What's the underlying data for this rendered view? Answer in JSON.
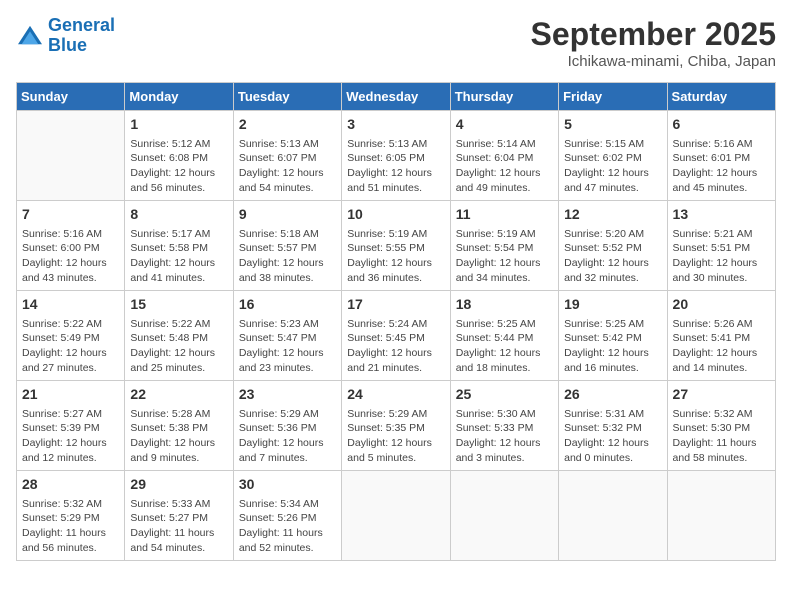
{
  "logo": {
    "line1": "General",
    "line2": "Blue"
  },
  "title": "September 2025",
  "subtitle": "Ichikawa-minami, Chiba, Japan",
  "headers": [
    "Sunday",
    "Monday",
    "Tuesday",
    "Wednesday",
    "Thursday",
    "Friday",
    "Saturday"
  ],
  "weeks": [
    [
      {
        "day": "",
        "info": ""
      },
      {
        "day": "1",
        "info": "Sunrise: 5:12 AM\nSunset: 6:08 PM\nDaylight: 12 hours\nand 56 minutes."
      },
      {
        "day": "2",
        "info": "Sunrise: 5:13 AM\nSunset: 6:07 PM\nDaylight: 12 hours\nand 54 minutes."
      },
      {
        "day": "3",
        "info": "Sunrise: 5:13 AM\nSunset: 6:05 PM\nDaylight: 12 hours\nand 51 minutes."
      },
      {
        "day": "4",
        "info": "Sunrise: 5:14 AM\nSunset: 6:04 PM\nDaylight: 12 hours\nand 49 minutes."
      },
      {
        "day": "5",
        "info": "Sunrise: 5:15 AM\nSunset: 6:02 PM\nDaylight: 12 hours\nand 47 minutes."
      },
      {
        "day": "6",
        "info": "Sunrise: 5:16 AM\nSunset: 6:01 PM\nDaylight: 12 hours\nand 45 minutes."
      }
    ],
    [
      {
        "day": "7",
        "info": "Sunrise: 5:16 AM\nSunset: 6:00 PM\nDaylight: 12 hours\nand 43 minutes."
      },
      {
        "day": "8",
        "info": "Sunrise: 5:17 AM\nSunset: 5:58 PM\nDaylight: 12 hours\nand 41 minutes."
      },
      {
        "day": "9",
        "info": "Sunrise: 5:18 AM\nSunset: 5:57 PM\nDaylight: 12 hours\nand 38 minutes."
      },
      {
        "day": "10",
        "info": "Sunrise: 5:19 AM\nSunset: 5:55 PM\nDaylight: 12 hours\nand 36 minutes."
      },
      {
        "day": "11",
        "info": "Sunrise: 5:19 AM\nSunset: 5:54 PM\nDaylight: 12 hours\nand 34 minutes."
      },
      {
        "day": "12",
        "info": "Sunrise: 5:20 AM\nSunset: 5:52 PM\nDaylight: 12 hours\nand 32 minutes."
      },
      {
        "day": "13",
        "info": "Sunrise: 5:21 AM\nSunset: 5:51 PM\nDaylight: 12 hours\nand 30 minutes."
      }
    ],
    [
      {
        "day": "14",
        "info": "Sunrise: 5:22 AM\nSunset: 5:49 PM\nDaylight: 12 hours\nand 27 minutes."
      },
      {
        "day": "15",
        "info": "Sunrise: 5:22 AM\nSunset: 5:48 PM\nDaylight: 12 hours\nand 25 minutes."
      },
      {
        "day": "16",
        "info": "Sunrise: 5:23 AM\nSunset: 5:47 PM\nDaylight: 12 hours\nand 23 minutes."
      },
      {
        "day": "17",
        "info": "Sunrise: 5:24 AM\nSunset: 5:45 PM\nDaylight: 12 hours\nand 21 minutes."
      },
      {
        "day": "18",
        "info": "Sunrise: 5:25 AM\nSunset: 5:44 PM\nDaylight: 12 hours\nand 18 minutes."
      },
      {
        "day": "19",
        "info": "Sunrise: 5:25 AM\nSunset: 5:42 PM\nDaylight: 12 hours\nand 16 minutes."
      },
      {
        "day": "20",
        "info": "Sunrise: 5:26 AM\nSunset: 5:41 PM\nDaylight: 12 hours\nand 14 minutes."
      }
    ],
    [
      {
        "day": "21",
        "info": "Sunrise: 5:27 AM\nSunset: 5:39 PM\nDaylight: 12 hours\nand 12 minutes."
      },
      {
        "day": "22",
        "info": "Sunrise: 5:28 AM\nSunset: 5:38 PM\nDaylight: 12 hours\nand 9 minutes."
      },
      {
        "day": "23",
        "info": "Sunrise: 5:29 AM\nSunset: 5:36 PM\nDaylight: 12 hours\nand 7 minutes."
      },
      {
        "day": "24",
        "info": "Sunrise: 5:29 AM\nSunset: 5:35 PM\nDaylight: 12 hours\nand 5 minutes."
      },
      {
        "day": "25",
        "info": "Sunrise: 5:30 AM\nSunset: 5:33 PM\nDaylight: 12 hours\nand 3 minutes."
      },
      {
        "day": "26",
        "info": "Sunrise: 5:31 AM\nSunset: 5:32 PM\nDaylight: 12 hours\nand 0 minutes."
      },
      {
        "day": "27",
        "info": "Sunrise: 5:32 AM\nSunset: 5:30 PM\nDaylight: 11 hours\nand 58 minutes."
      }
    ],
    [
      {
        "day": "28",
        "info": "Sunrise: 5:32 AM\nSunset: 5:29 PM\nDaylight: 11 hours\nand 56 minutes."
      },
      {
        "day": "29",
        "info": "Sunrise: 5:33 AM\nSunset: 5:27 PM\nDaylight: 11 hours\nand 54 minutes."
      },
      {
        "day": "30",
        "info": "Sunrise: 5:34 AM\nSunset: 5:26 PM\nDaylight: 11 hours\nand 52 minutes."
      },
      {
        "day": "",
        "info": ""
      },
      {
        "day": "",
        "info": ""
      },
      {
        "day": "",
        "info": ""
      },
      {
        "day": "",
        "info": ""
      }
    ]
  ]
}
